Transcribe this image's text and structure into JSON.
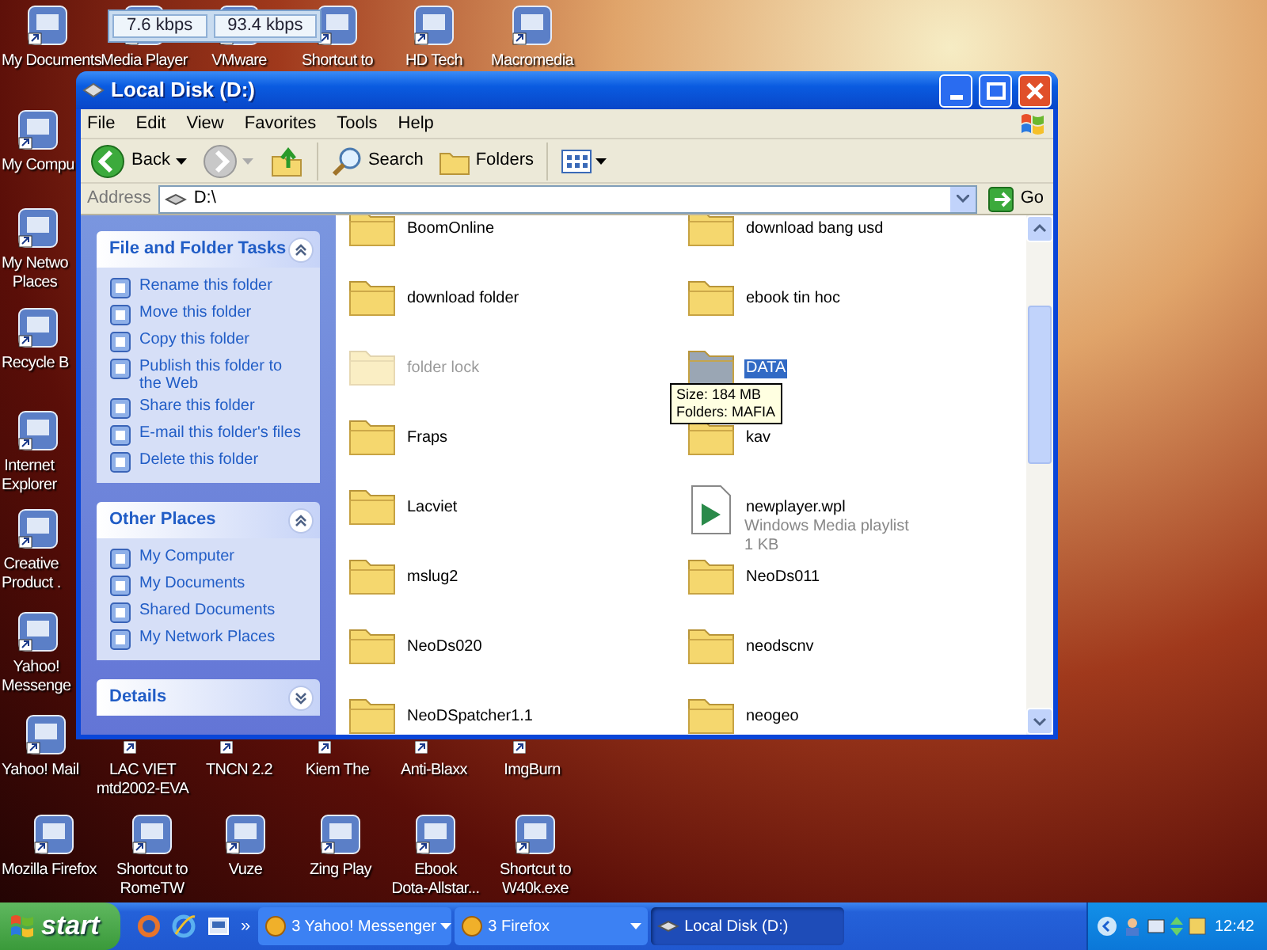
{
  "desktop_icons": [
    {
      "lines": [
        "My Documents"
      ]
    },
    {
      "lines": [
        "Media Player"
      ]
    },
    {
      "lines": [
        "VMware"
      ]
    },
    {
      "lines": [
        "Shortcut to"
      ]
    },
    {
      "lines": [
        "HD Tech"
      ]
    },
    {
      "lines": [
        "Macromedia"
      ]
    },
    {
      "lines": [
        "My Compu"
      ]
    },
    {
      "lines": [
        "My Netwo",
        "Places"
      ]
    },
    {
      "lines": [
        "Recycle B"
      ]
    },
    {
      "lines": [
        "Internet",
        "Explorer"
      ]
    },
    {
      "lines": [
        "Creative",
        "Product ."
      ]
    },
    {
      "lines": [
        "Yahoo!",
        "Messenge"
      ]
    },
    {
      "lines": [
        "Yahoo! Mail"
      ]
    },
    {
      "lines": [
        "LAC VIET",
        "mtd2002-EVA"
      ]
    },
    {
      "lines": [
        "TNCN 2.2"
      ]
    },
    {
      "lines": [
        "Kiem The"
      ]
    },
    {
      "lines": [
        "Anti-Blaxx"
      ]
    },
    {
      "lines": [
        "ImgBurn"
      ]
    },
    {
      "lines": [
        "Mozilla Firefox"
      ]
    },
    {
      "lines": [
        "Shortcut to",
        "RomeTW"
      ]
    },
    {
      "lines": [
        "Vuze"
      ]
    },
    {
      "lines": [
        "Zing Play"
      ]
    },
    {
      "lines": [
        "Ebook",
        "Dota-Allstar..."
      ]
    },
    {
      "lines": [
        "Shortcut to",
        "W40k.exe"
      ]
    }
  ],
  "net_meter": {
    "upload": "7.6 kbps",
    "download": "93.4 kbps"
  },
  "window": {
    "title": "Local Disk (D:)",
    "menu": [
      "File",
      "Edit",
      "View",
      "Favorites",
      "Tools",
      "Help"
    ],
    "toolbar": {
      "back": "Back",
      "search": "Search",
      "folders": "Folders"
    },
    "address": {
      "label": "Address",
      "value": "D:\\",
      "go": "Go"
    },
    "sidebar": [
      {
        "title": "File and Folder Tasks",
        "expanded": true,
        "items": [
          {
            "label": "Rename this folder"
          },
          {
            "label": "Move this folder"
          },
          {
            "label": "Copy this folder"
          },
          {
            "label": "Publish this folder to the Web"
          },
          {
            "label": "Share this folder"
          },
          {
            "label": "E-mail this folder's files"
          },
          {
            "label": "Delete this folder"
          }
        ]
      },
      {
        "title": "Other Places",
        "expanded": true,
        "items": [
          {
            "label": "My Computer"
          },
          {
            "label": "My Documents"
          },
          {
            "label": "Shared Documents"
          },
          {
            "label": "My Network Places"
          }
        ]
      },
      {
        "title": "Details",
        "expanded": false
      }
    ],
    "files": [
      {
        "name": "BoomOnline",
        "kind": "folder",
        "selected": false,
        "hidden": false
      },
      {
        "name": "download bang usd",
        "kind": "folder",
        "selected": false,
        "hidden": false
      },
      {
        "name": "download folder",
        "kind": "folder",
        "selected": false,
        "hidden": false
      },
      {
        "name": "ebook tin hoc",
        "kind": "folder",
        "selected": false,
        "hidden": false
      },
      {
        "name": "folder lock",
        "kind": "folder",
        "selected": false,
        "hidden": true
      },
      {
        "name": "DATA",
        "kind": "folder",
        "selected": true,
        "hidden": false
      },
      {
        "name": "Fraps",
        "kind": "folder",
        "selected": false,
        "hidden": false
      },
      {
        "name": "kav",
        "kind": "folder",
        "selected": false,
        "hidden": false
      },
      {
        "name": "Lacviet",
        "kind": "folder",
        "selected": false,
        "hidden": false
      },
      {
        "name": "newplayer.wpl",
        "kind": "playlist",
        "selected": false,
        "hidden": false,
        "type": "Windows Media playlist",
        "size": "1 KB"
      },
      {
        "name": "mslug2",
        "kind": "folder",
        "selected": false,
        "hidden": false
      },
      {
        "name": "NeoDs011",
        "kind": "folder",
        "selected": false,
        "hidden": false
      },
      {
        "name": "NeoDs020",
        "kind": "folder",
        "selected": false,
        "hidden": false
      },
      {
        "name": "neodscnv",
        "kind": "folder",
        "selected": false,
        "hidden": false
      },
      {
        "name": "NeoDSpatcher1.1",
        "kind": "folder",
        "selected": false,
        "hidden": false
      },
      {
        "name": "neogeo",
        "kind": "folder",
        "selected": false,
        "hidden": false
      }
    ],
    "tooltip": [
      "Size: 184 MB",
      "Folders: MAFIA"
    ]
  },
  "taskbar": {
    "start": "start",
    "overflow": "»",
    "buttons": [
      {
        "label": "3 Yahoo! Messenger",
        "kind": "group",
        "selected": false
      },
      {
        "label": "3 Firefox",
        "kind": "group",
        "selected": false
      },
      {
        "label": "Local Disk (D:)",
        "kind": "window",
        "selected": true
      }
    ],
    "clock": "12:42"
  }
}
